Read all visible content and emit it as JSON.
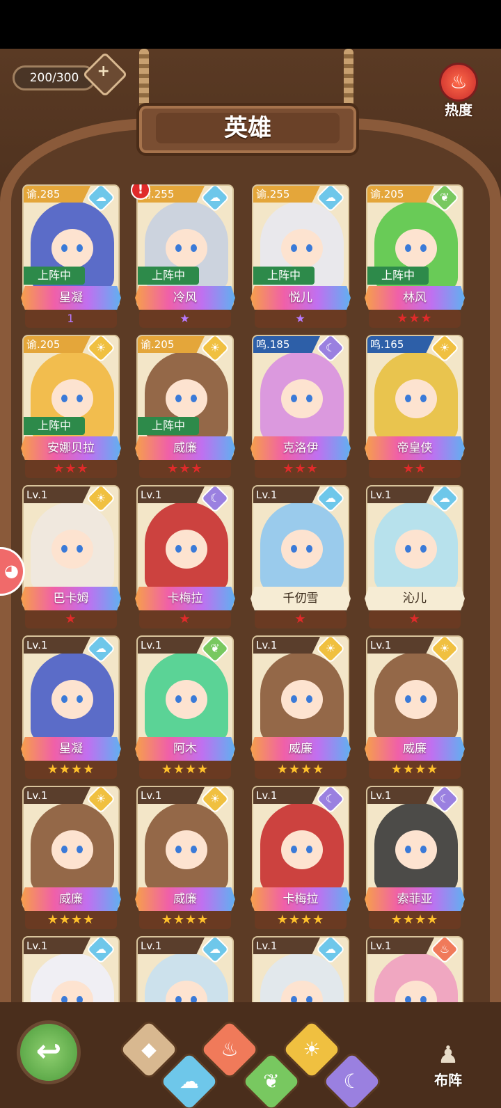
{
  "header": {
    "counter": "200/300",
    "heat_label": "热度",
    "title": "英雄"
  },
  "heroes": [
    {
      "tag": "谕.285",
      "tag_type": "yu",
      "element": "water",
      "deployed": "上阵中",
      "name": "星凝",
      "rating": "1",
      "rating_type": "wing",
      "art": "#4a5ec8",
      "alert": "!"
    },
    {
      "tag": "谕.255",
      "tag_type": "yu",
      "element": "water",
      "deployed": "上阵中",
      "name": "冷风",
      "rating": "★",
      "rating_type": "wing",
      "art": "#c8d0e0"
    },
    {
      "tag": "谕.255",
      "tag_type": "yu",
      "element": "water",
      "deployed": "上阵中",
      "name": "悦儿",
      "rating": "★",
      "rating_type": "wing",
      "art": "#e8e8f0"
    },
    {
      "tag": "谕.205",
      "tag_type": "yu",
      "element": "wood",
      "deployed": "上阵中",
      "name": "林风",
      "rating": "★★★",
      "rating_type": "red",
      "art": "#5ac84a"
    },
    {
      "tag": "谕.205",
      "tag_type": "yu",
      "element": "light",
      "deployed": "上阵中",
      "name": "安娜贝拉",
      "rating": "★★★",
      "rating_type": "red",
      "art": "#f2b840"
    },
    {
      "tag": "谕.205",
      "tag_type": "yu",
      "element": "light",
      "deployed": "上阵中",
      "name": "威廉",
      "rating": "★★★",
      "rating_type": "red",
      "art": "#8a5a3a"
    },
    {
      "tag": "鸣.185",
      "tag_type": "ming",
      "element": "dark",
      "deployed": "",
      "name": "克洛伊",
      "rating": "★★★",
      "rating_type": "red",
      "art": "#d890e0"
    },
    {
      "tag": "鸣.165",
      "tag_type": "ming",
      "element": "light",
      "deployed": "",
      "name": "帝皇侠",
      "rating": "★★",
      "rating_type": "red",
      "art": "#e8c040"
    },
    {
      "tag": "Lv.1",
      "tag_type": "lv",
      "element": "light",
      "deployed": "",
      "name": "巴卡姆",
      "rating": "★",
      "rating_type": "red",
      "art": "#f0e8e0"
    },
    {
      "tag": "Lv.1",
      "tag_type": "lv",
      "element": "dark",
      "deployed": "",
      "name": "卡梅拉",
      "rating": "★",
      "rating_type": "red",
      "art": "#c83030"
    },
    {
      "tag": "Lv.1",
      "tag_type": "lv",
      "element": "water",
      "deployed": "",
      "name": "千仞雪",
      "rating": "★",
      "rating_type": "red",
      "art": "#90c8f0",
      "plain": true
    },
    {
      "tag": "Lv.1",
      "tag_type": "lv",
      "element": "water",
      "deployed": "",
      "name": "沁儿",
      "rating": "★",
      "rating_type": "red",
      "art": "#b0e0f0",
      "plain": true
    },
    {
      "tag": "Lv.1",
      "tag_type": "lv",
      "element": "water",
      "deployed": "",
      "name": "星凝",
      "rating": "★★★★",
      "rating_type": "gold",
      "art": "#4a5ec8"
    },
    {
      "tag": "Lv.1",
      "tag_type": "lv",
      "element": "wood",
      "deployed": "",
      "name": "阿木",
      "rating": "★★★★",
      "rating_type": "gold",
      "art": "#4ad090"
    },
    {
      "tag": "Lv.1",
      "tag_type": "lv",
      "element": "light",
      "deployed": "",
      "name": "威廉",
      "rating": "★★★★",
      "rating_type": "gold",
      "art": "#8a5a3a"
    },
    {
      "tag": "Lv.1",
      "tag_type": "lv",
      "element": "light",
      "deployed": "",
      "name": "威廉",
      "rating": "★★★★",
      "rating_type": "gold",
      "art": "#8a5a3a"
    },
    {
      "tag": "Lv.1",
      "tag_type": "lv",
      "element": "light",
      "deployed": "",
      "name": "威廉",
      "rating": "★★★★",
      "rating_type": "gold",
      "art": "#8a5a3a"
    },
    {
      "tag": "Lv.1",
      "tag_type": "lv",
      "element": "light",
      "deployed": "",
      "name": "威廉",
      "rating": "★★★★",
      "rating_type": "gold",
      "art": "#8a5a3a"
    },
    {
      "tag": "Lv.1",
      "tag_type": "lv",
      "element": "dark",
      "deployed": "",
      "name": "卡梅拉",
      "rating": "★★★★",
      "rating_type": "gold",
      "art": "#c83030"
    },
    {
      "tag": "Lv.1",
      "tag_type": "lv",
      "element": "dark",
      "deployed": "",
      "name": "索菲亚",
      "rating": "★★★★",
      "rating_type": "gold",
      "art": "#3a3a3a"
    },
    {
      "tag": "Lv.1",
      "tag_type": "lv",
      "element": "water",
      "deployed": "",
      "name": "",
      "rating": "",
      "rating_type": "gold",
      "art": "#f0f0f8"
    },
    {
      "tag": "Lv.1",
      "tag_type": "lv",
      "element": "water",
      "deployed": "",
      "name": "",
      "rating": "",
      "rating_type": "gold",
      "art": "#c8e0f0"
    },
    {
      "tag": "Lv.1",
      "tag_type": "lv",
      "element": "water",
      "deployed": "",
      "name": "",
      "rating": "",
      "rating_type": "gold",
      "art": "#e0e8f0"
    },
    {
      "tag": "Lv.1",
      "tag_type": "lv",
      "element": "fire",
      "deployed": "",
      "name": "",
      "rating": "",
      "rating_type": "gold",
      "art": "#f0a0c0"
    }
  ],
  "element_icons": {
    "water": "☁",
    "light": "☀",
    "dark": "☾",
    "wood": "❦",
    "fire": "♨"
  },
  "filters": [
    {
      "name": "all",
      "icon": "◆",
      "color": "#d8b890"
    },
    {
      "name": "water",
      "icon": "☁",
      "color": "#6ec7ea"
    },
    {
      "name": "fire",
      "icon": "♨",
      "color": "#f07a5a"
    },
    {
      "name": "wood",
      "icon": "❦",
      "color": "#78c860"
    },
    {
      "name": "light",
      "icon": "☀",
      "color": "#f0c040"
    },
    {
      "name": "dark",
      "icon": "☾",
      "color": "#9a80e0"
    }
  ],
  "footer": {
    "formation_label": "布阵",
    "back_icon": "↩",
    "side_icon": "◕"
  }
}
